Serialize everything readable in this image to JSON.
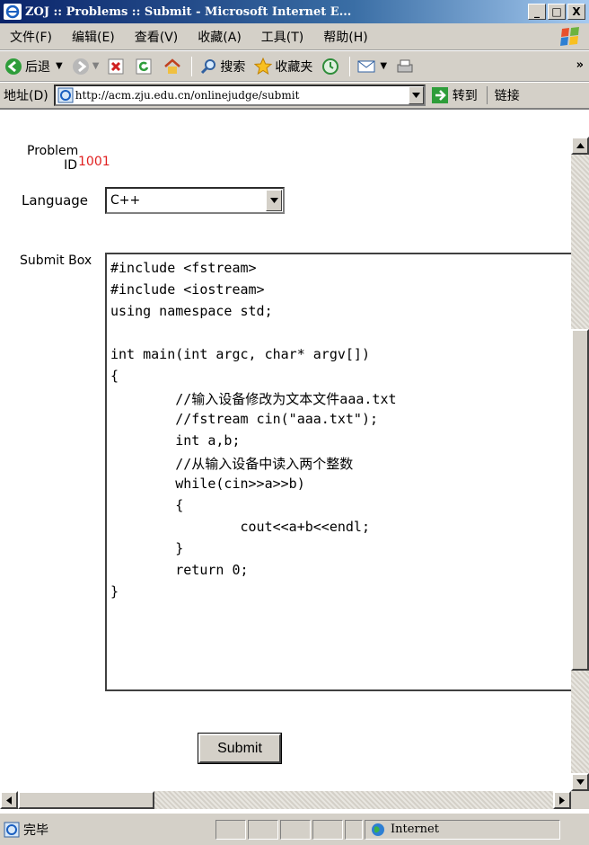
{
  "window": {
    "title": "ZOJ :: Problems :: Submit - Microsoft Internet E...",
    "minimize": "_",
    "maximize": "□",
    "close": "X"
  },
  "menu": [
    "文件(F)",
    "编辑(E)",
    "查看(V)",
    "收藏(A)",
    "工具(T)",
    "帮助(H)"
  ],
  "toolbar": {
    "back_label": "后退",
    "search_label": "搜索",
    "favorites_label": "收藏夹",
    "overflow": "»"
  },
  "address": {
    "label": "地址(D)",
    "url": "http://acm.zju.edu.cn/onlinejudge/submit",
    "go_label": "转到",
    "links_label": "链接"
  },
  "form": {
    "problem_id_label": "Problem ID",
    "problem_id": "1001",
    "language_label": "Language",
    "language_value": "C++",
    "submit_box_label": "Submit Box",
    "submit_label": "Submit"
  },
  "code_lines": [
    "#include <fstream>",
    "#include <iostream>",
    "using namespace std;",
    "",
    "int main(int argc, char* argv[])",
    "{",
    "        //输入设备修改为文本文件aaa.txt",
    "        //fstream cin(\"aaa.txt\");",
    "        int a,b;",
    "        //从输入设备中读入两个整数",
    "        while(cin>>a>>b)",
    "        {",
    "                cout<<a+b<<endl;",
    "        }",
    "        return 0;",
    "}"
  ],
  "status": {
    "text": "完毕",
    "zone": "Internet"
  },
  "colors": {
    "problem_id": "#e02020",
    "titlebar": "#0a246a",
    "chrome": "#d4d0c8"
  }
}
